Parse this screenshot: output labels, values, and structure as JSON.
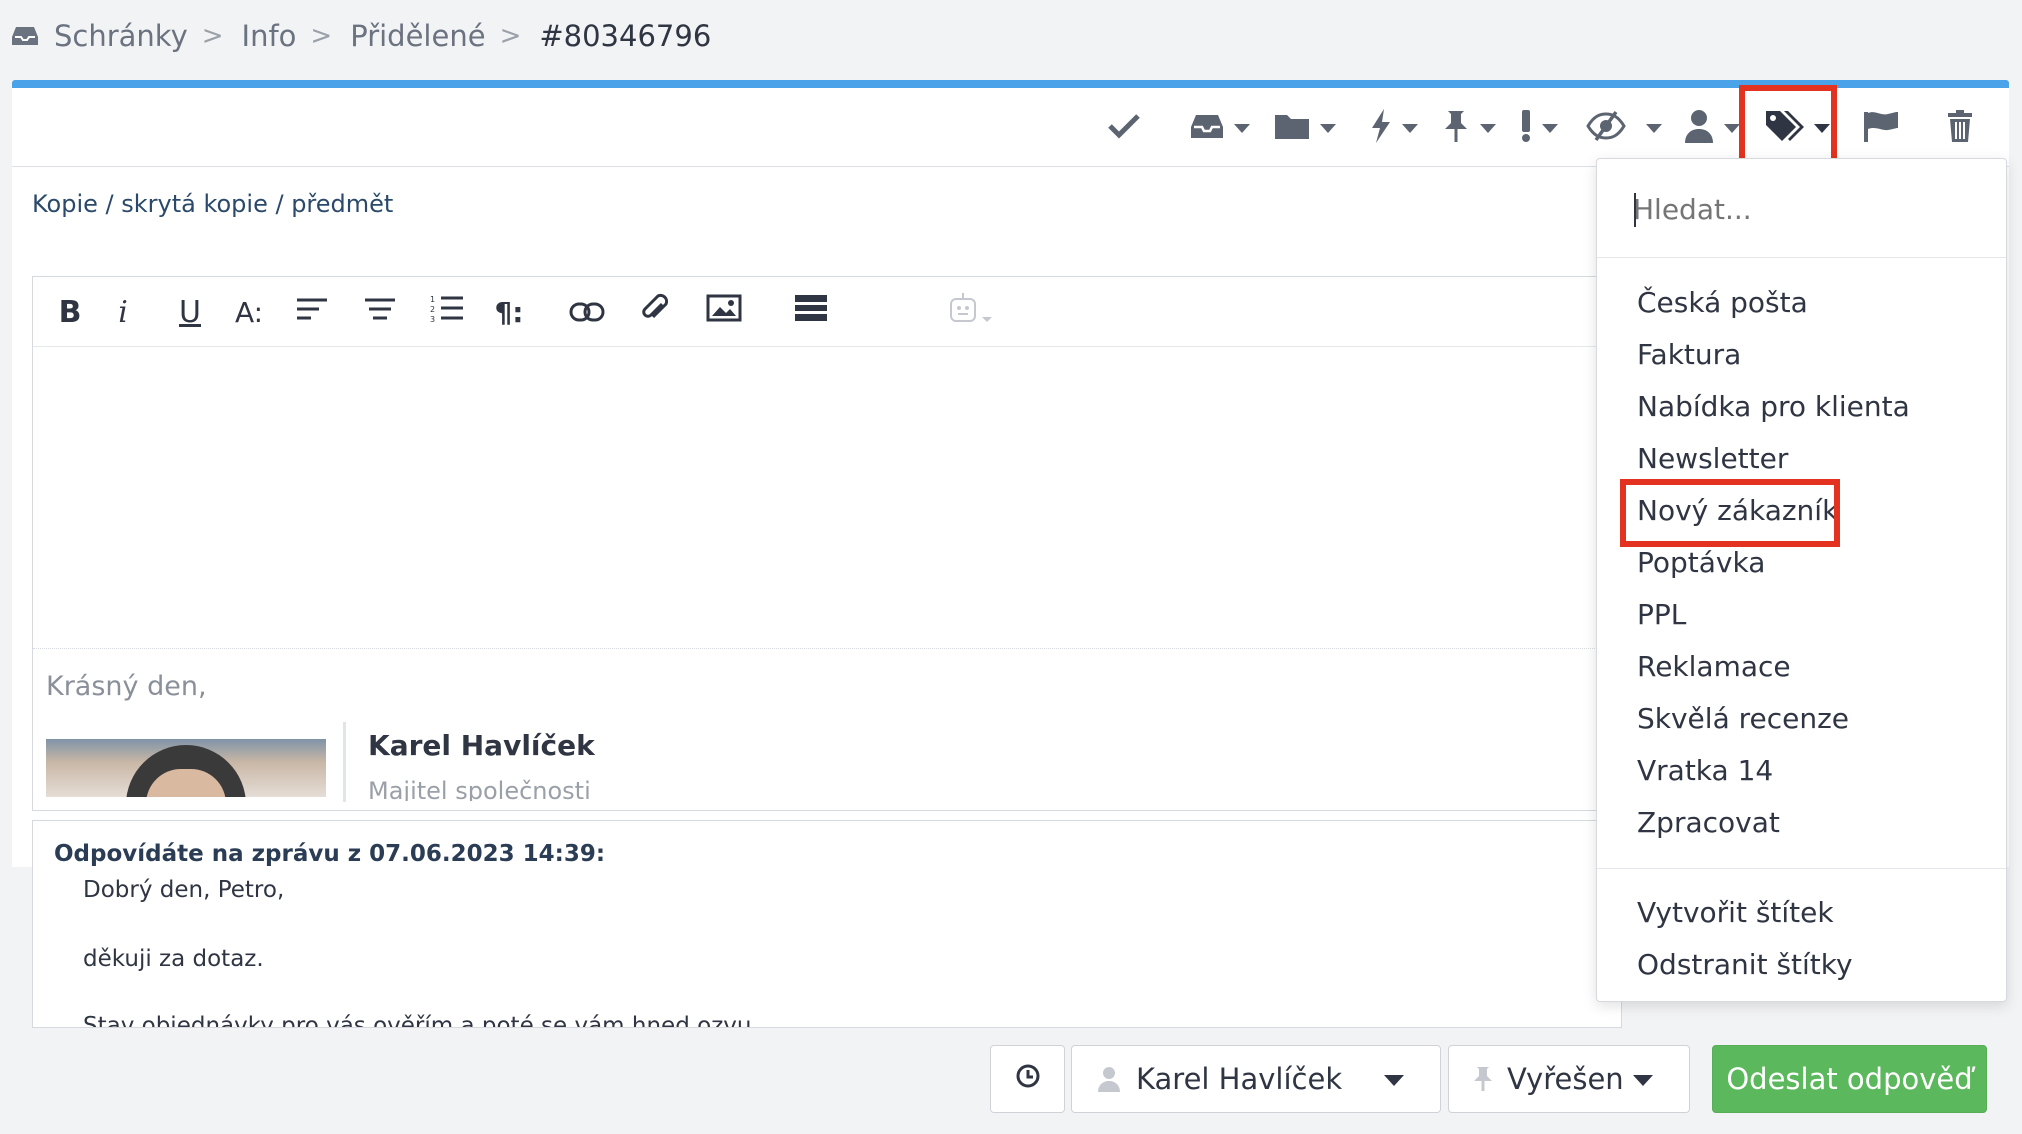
{
  "breadcrumb": {
    "items": [
      "Schránky",
      "Info",
      "Přidělené"
    ],
    "separator": ">",
    "current": "#80346796"
  },
  "toolbar": {
    "icons": [
      "check-icon",
      "inbox-icon",
      "folder-icon",
      "bolt-icon",
      "pin-icon",
      "exclamation-icon",
      "eye-slash-icon",
      "user-icon",
      "tags-icon",
      "flag-icon",
      "trash-icon"
    ],
    "highlighted": "tags-icon"
  },
  "compose": {
    "cc_link": "Kopie / skrytá kopie / předmět",
    "editor_tools": [
      "B",
      "i",
      "U",
      "A:",
      "align-left",
      "align-center",
      "list-ordered",
      "¶:",
      "link",
      "attachment",
      "image",
      "template",
      "emoji"
    ],
    "signature": {
      "greeting": "Krásný den,",
      "name": "Karel Havlíček",
      "role": "Majitel společnosti"
    }
  },
  "quote": {
    "header": "Odpovídáte na zprávu z 07.06.2023 14:39:",
    "lines": [
      "Dobrý den, Petro,",
      "",
      "děkuji za dotaz.",
      "",
      "Stav objednávky pro vás ověřím a poté se vám hned ozvu."
    ]
  },
  "bottom": {
    "assignee": "Karel Havlíček",
    "status": "Vyřešen",
    "send_label": "Odeslat odpověď"
  },
  "tag_dropdown": {
    "search_placeholder": "Hledat...",
    "tags": [
      "Česká pošta",
      "Faktura",
      "Nabídka pro klienta",
      "Newsletter",
      "Nový zákazník",
      "Poptávka",
      "PPL",
      "Reklamace",
      "Skvělá recenze",
      "Vratka 14",
      "Zpracovat"
    ],
    "highlighted_tag": "Nový zákazník",
    "actions": [
      "Vytvořit štítek",
      "Odstranit štítky"
    ]
  },
  "colors": {
    "accent_bar": "#4aa3e8",
    "send_button": "#5cb85c",
    "highlight": "#e3321f"
  }
}
